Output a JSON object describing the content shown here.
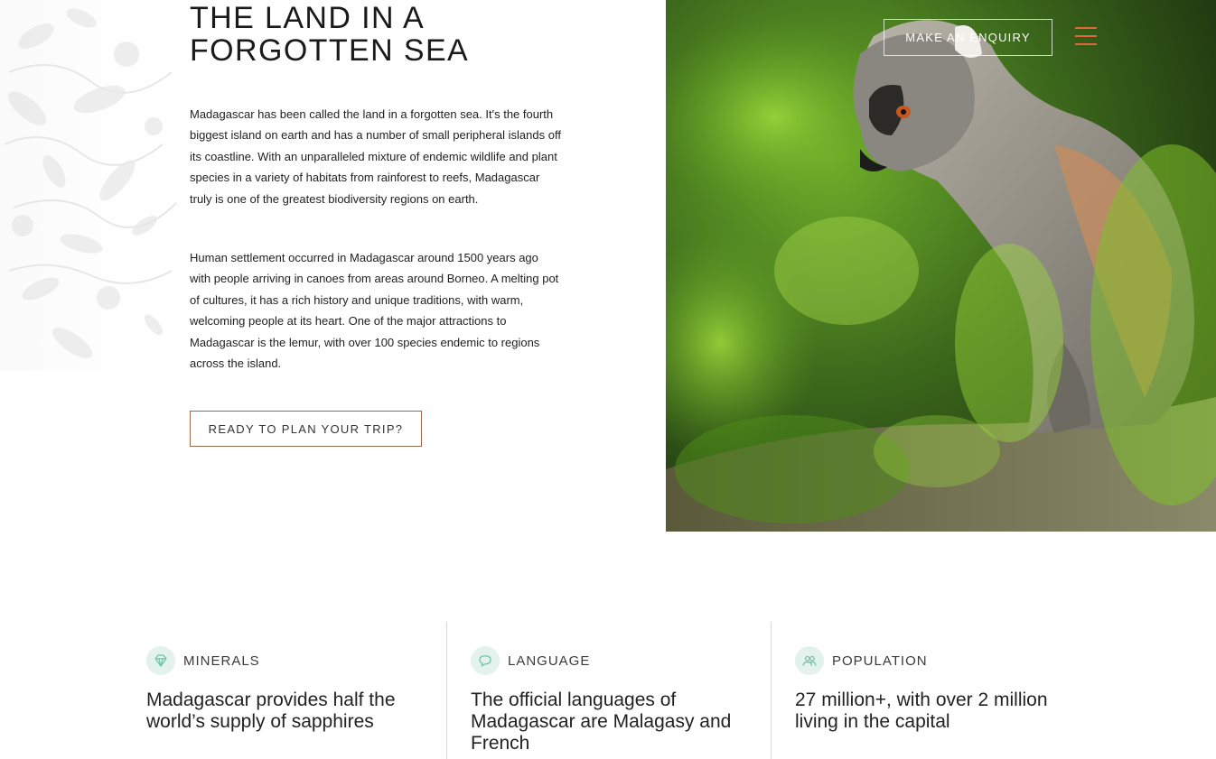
{
  "page": {
    "title_line1": "THE LAND IN A",
    "title_line2": "FORGOTTEN SEA",
    "paragraph1": "Madagascar has been called the land in a forgotten sea. It's the fourth biggest island on earth and has a number of small peripheral islands off its coastline. With an unparalleled mixture of endemic wildlife and plant species in a variety of habitats from rainforest to reefs, Madagascar truly is one of the greatest biodiversity regions on earth.",
    "paragraph2": "Human settlement occurred in Madagascar around 1500 years ago with people arriving in canoes from areas around Borneo. A melting pot of cultures, it has a rich history and unique traditions, with warm, welcoming people at its heart. One of the major attractions to Madagascar is the lemur, with over 100 species endemic to regions across the island.",
    "cta_label": "READY TO PLAN YOUR TRIP?"
  },
  "header": {
    "enquiry_label": "MAKE AN ENQUIRY",
    "menu_icon": "hamburger-menu-icon",
    "accent_color": "#e0683a"
  },
  "hero_image": {
    "subject": "ring-tailed-lemur-photo"
  },
  "facts": [
    {
      "icon": "gem-icon",
      "label": "MINERALS",
      "text": "Madagascar provides half the world’s supply of sapphires"
    },
    {
      "icon": "speech-bubble-icon",
      "label": "LANGUAGE",
      "text": "The official languages of Madagascar are Malagasy and French"
    },
    {
      "icon": "people-icon",
      "label": "POPULATION",
      "text": "27 million+, with over 2 million living in the capital"
    }
  ],
  "colors": {
    "icon_bg": "#e3f2ec",
    "icon_stroke": "#6cc4a4",
    "button_border": "#9a6a4c"
  }
}
